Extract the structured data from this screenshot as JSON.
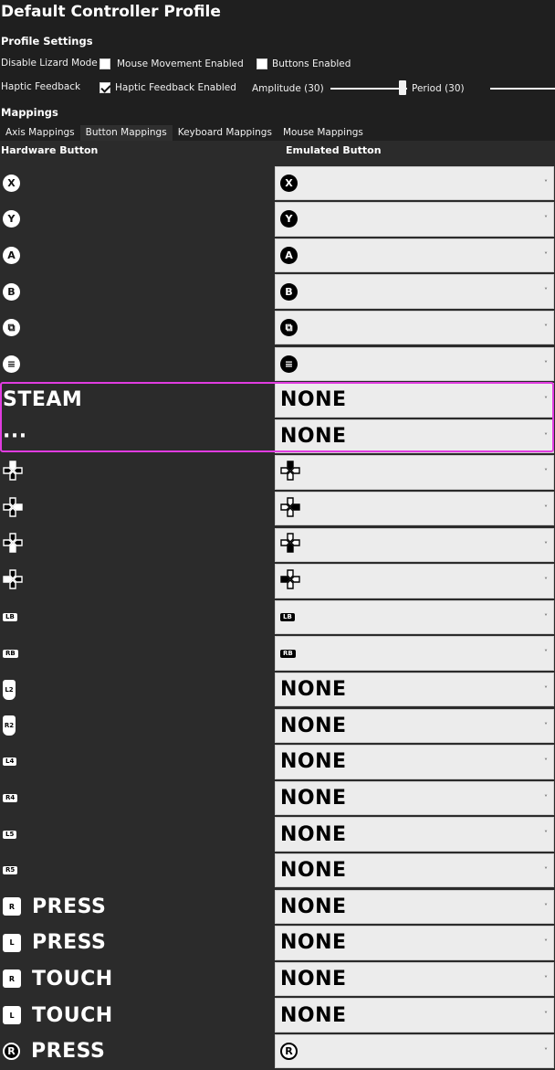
{
  "window": {
    "title": "Default Controller Profile"
  },
  "profile_settings": {
    "heading": "Profile Settings",
    "disable_lizard_label": "Disable Lizard Mode",
    "mouse_movement_label": "Mouse Movement Enabled",
    "mouse_movement_checked": false,
    "buttons_enabled_label": "Buttons Enabled",
    "buttons_enabled_checked": false,
    "haptic_label": "Haptic Feedback",
    "haptic_enabled_label": "Haptic Feedback Enabled",
    "haptic_enabled_checked": true,
    "amplitude_label": "Amplitude (30)",
    "period_label": "Period (30)"
  },
  "mappings": {
    "heading": "Mappings",
    "tabs": [
      "Axis Mappings",
      "Button Mappings",
      "Keyboard Mappings",
      "Mouse Mappings"
    ],
    "active_tab": "Button Mappings",
    "columns": {
      "hardware": "Hardware Button",
      "emulated": "Emulated Button"
    }
  },
  "rows": [
    {
      "hw": {
        "kind": "circle",
        "glyph": "X",
        "icon": "x-button-icon"
      },
      "em": {
        "kind": "circle",
        "glyph": "X",
        "icon": "x-button-icon"
      }
    },
    {
      "hw": {
        "kind": "circle",
        "glyph": "Y",
        "icon": "y-button-icon"
      },
      "em": {
        "kind": "circle",
        "glyph": "Y",
        "icon": "y-button-icon"
      }
    },
    {
      "hw": {
        "kind": "circle",
        "glyph": "A",
        "icon": "a-button-icon"
      },
      "em": {
        "kind": "circle",
        "glyph": "A",
        "icon": "a-button-icon"
      }
    },
    {
      "hw": {
        "kind": "circle",
        "glyph": "B",
        "icon": "b-button-icon"
      },
      "em": {
        "kind": "circle",
        "glyph": "B",
        "icon": "b-button-icon"
      }
    },
    {
      "hw": {
        "kind": "circle",
        "glyph": "⧉",
        "icon": "view-button-icon"
      },
      "em": {
        "kind": "circle",
        "glyph": "⧉",
        "icon": "view-button-icon"
      }
    },
    {
      "hw": {
        "kind": "circle",
        "glyph": "≡",
        "icon": "menu-button-icon"
      },
      "em": {
        "kind": "circle",
        "glyph": "≡",
        "icon": "menu-button-icon"
      }
    },
    {
      "hw": {
        "kind": "text",
        "text": "STEAM"
      },
      "em": {
        "kind": "text",
        "text": "NONE"
      }
    },
    {
      "hw": {
        "kind": "text",
        "text": "···"
      },
      "em": {
        "kind": "text",
        "text": "NONE"
      }
    },
    {
      "hw": {
        "kind": "dpad",
        "dir": "up",
        "icon": "dpad-up-icon"
      },
      "em": {
        "kind": "dpad",
        "dir": "up",
        "icon": "dpad-up-icon"
      }
    },
    {
      "hw": {
        "kind": "dpad",
        "dir": "right",
        "icon": "dpad-right-icon"
      },
      "em": {
        "kind": "dpad",
        "dir": "right",
        "icon": "dpad-right-icon"
      }
    },
    {
      "hw": {
        "kind": "dpad",
        "dir": "down",
        "icon": "dpad-down-icon"
      },
      "em": {
        "kind": "dpad",
        "dir": "down",
        "icon": "dpad-down-icon"
      }
    },
    {
      "hw": {
        "kind": "dpad",
        "dir": "left",
        "icon": "dpad-left-icon"
      },
      "em": {
        "kind": "dpad",
        "dir": "left",
        "icon": "dpad-left-icon"
      }
    },
    {
      "hw": {
        "kind": "pill",
        "text": "LB",
        "icon": "lb-bumper-icon"
      },
      "em": {
        "kind": "pill",
        "text": "LB",
        "icon": "lb-bumper-icon"
      }
    },
    {
      "hw": {
        "kind": "pill",
        "text": "RB",
        "icon": "rb-bumper-icon"
      },
      "em": {
        "kind": "pill",
        "text": "RB",
        "icon": "rb-bumper-icon"
      }
    },
    {
      "hw": {
        "kind": "trig",
        "text": "L2",
        "icon": "l2-trigger-icon"
      },
      "em": {
        "kind": "text",
        "text": "NONE"
      }
    },
    {
      "hw": {
        "kind": "trig",
        "text": "R2",
        "icon": "r2-trigger-icon"
      },
      "em": {
        "kind": "text",
        "text": "NONE"
      }
    },
    {
      "hw": {
        "kind": "pill",
        "text": "L4",
        "icon": "l4-button-icon"
      },
      "em": {
        "kind": "text",
        "text": "NONE"
      }
    },
    {
      "hw": {
        "kind": "pill",
        "text": "R4",
        "icon": "r4-button-icon"
      },
      "em": {
        "kind": "text",
        "text": "NONE"
      }
    },
    {
      "hw": {
        "kind": "pill",
        "text": "L5",
        "icon": "l5-button-icon"
      },
      "em": {
        "kind": "text",
        "text": "NONE"
      }
    },
    {
      "hw": {
        "kind": "pill",
        "text": "R5",
        "icon": "r5-button-icon"
      },
      "em": {
        "kind": "text",
        "text": "NONE"
      }
    },
    {
      "hw": {
        "kind": "sqtext",
        "sq": "R",
        "text": "PRESS",
        "icon": "right-trackpad-icon"
      },
      "em": {
        "kind": "text",
        "text": "NONE"
      }
    },
    {
      "hw": {
        "kind": "sqtext",
        "sq": "L",
        "text": "PRESS",
        "icon": "left-trackpad-icon"
      },
      "em": {
        "kind": "text",
        "text": "NONE"
      }
    },
    {
      "hw": {
        "kind": "sqtext",
        "sq": "R",
        "text": "TOUCH",
        "icon": "right-trackpad-icon"
      },
      "em": {
        "kind": "text",
        "text": "NONE"
      }
    },
    {
      "hw": {
        "kind": "sqtext",
        "sq": "L",
        "text": "TOUCH",
        "icon": "left-trackpad-icon"
      },
      "em": {
        "kind": "text",
        "text": "NONE"
      }
    },
    {
      "hw": {
        "kind": "circtext",
        "glyph": "R",
        "text": "PRESS",
        "icon": "right-stick-icon"
      },
      "em": {
        "kind": "circle",
        "glyph": "R",
        "icon": "right-stick-icon",
        "ring": true
      }
    }
  ],
  "colors": {
    "highlight": "#e03ce0",
    "panel": "#2b2b2b",
    "background": "#1f1f1f",
    "dropdown": "#ececec"
  }
}
